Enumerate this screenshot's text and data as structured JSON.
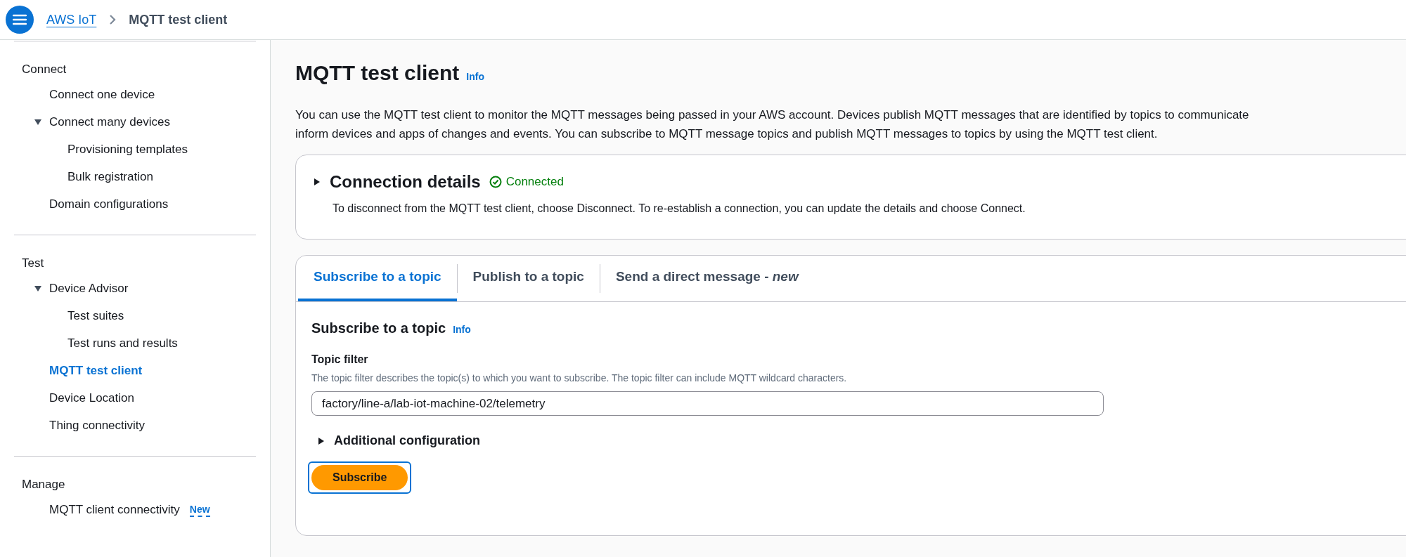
{
  "header": {
    "breadcrumbs": [
      {
        "label": "AWS IoT",
        "kind": "link"
      },
      {
        "label": "MQTT test client",
        "kind": "current"
      }
    ]
  },
  "sidebar": {
    "sections": [
      {
        "title": "Connect",
        "items": [
          {
            "label": "Connect one device",
            "selected": false
          },
          {
            "label": "Connect many devices",
            "selected": false,
            "expanded": true,
            "children": [
              {
                "label": "Provisioning templates",
                "selected": false
              },
              {
                "label": "Bulk registration",
                "selected": false
              }
            ]
          },
          {
            "label": "Domain configurations",
            "selected": false
          }
        ]
      },
      {
        "title": "Test",
        "items": [
          {
            "label": "Device Advisor",
            "selected": false,
            "expanded": true,
            "children": [
              {
                "label": "Test suites",
                "selected": false
              },
              {
                "label": "Test runs and results",
                "selected": false
              }
            ]
          },
          {
            "label": "MQTT test client",
            "selected": true
          },
          {
            "label": "Device Location",
            "selected": false
          },
          {
            "label": "Thing connectivity",
            "selected": false
          }
        ]
      },
      {
        "title": "Manage",
        "items": [
          {
            "label": "MQTT client connectivity",
            "selected": false,
            "badge": "New"
          }
        ]
      }
    ]
  },
  "page": {
    "title": "MQTT test client",
    "info": "Info",
    "description_lines": [
      "You can use the MQTT test client to monitor the MQTT messages being passed in your AWS account. Devices publish MQTT messages that are identified by topics to communicate",
      "inform devices and apps of changes and events. You can subscribe to MQTT message topics and publish MQTT messages to topics by using the MQTT test client."
    ]
  },
  "connection": {
    "title": "Connection details",
    "expanded": false,
    "status": "Connected",
    "description": "To disconnect from the MQTT test client, choose Disconnect. To re-establish a connection, you can update the details and choose Connect."
  },
  "tabs": [
    {
      "label": "Subscribe to a topic",
      "selected": true
    },
    {
      "label": "Publish to a topic",
      "selected": false
    },
    {
      "label": "Send a direct message - *new*",
      "selected": false
    }
  ],
  "subscribe": {
    "title": "Subscribe to a topic",
    "info": "Info",
    "field_label": "Topic filter",
    "field_description": "The topic filter describes the topic(s) to which you want to subscribe. The topic filter can include MQTT wildcard characters.",
    "value": "factory/line-a/lab-iot-machine-02/telemetry",
    "additional": {
      "label": "Additional configuration",
      "expanded": false
    },
    "button": "Subscribe"
  }
}
